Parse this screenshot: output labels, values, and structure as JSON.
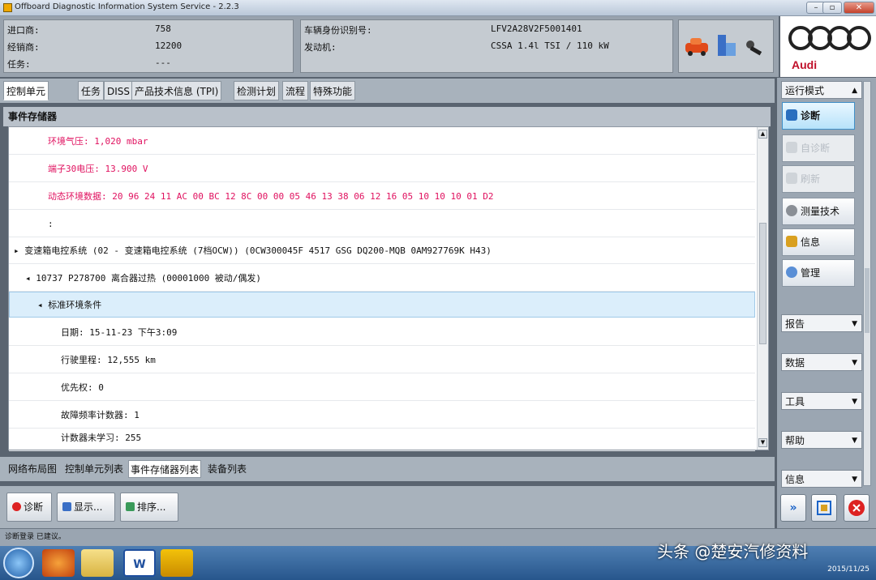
{
  "window": {
    "title": "Offboard Diagnostic Information System Service - 2.2.3",
    "minimize": "–",
    "restore": "▫",
    "close": "✕"
  },
  "header": {
    "left": [
      {
        "label": "进口商:",
        "value": "758"
      },
      {
        "label": "经销商:",
        "value": "12200"
      },
      {
        "label": "任务:",
        "value": "---"
      }
    ],
    "right": [
      {
        "label": "车辆身份识别号:",
        "value": "LFV2A28V2F5001401"
      },
      {
        "label": "发动机:",
        "value": "CSSA 1.4l TSI / 110 kW"
      }
    ],
    "brand": "Audi"
  },
  "tabs": [
    "控制单元",
    "任务",
    "DISS",
    "产品技术信息 (TPI)",
    "检测计划",
    "流程",
    "特殊功能"
  ],
  "panel_title": "事件存储器",
  "event_lines": [
    {
      "text": "环境气压: 1,020 mbar"
    },
    {
      "text": "端子30电压: 13.900 V"
    },
    {
      "text": "动态环境数据: 20 96 24 11 AC 00 BC 12 8C 00 00 05 46 13 38 06 12 16 05 10 10 10 01 D2"
    },
    {
      "text": ":"
    },
    {
      "text": "▸ 变速箱电控系统 (02 - 变速箱电控系统 (7档OCW)) (0CW300045F    4517   GSG DQ200-MQB    0AM927769K    H43)"
    },
    {
      "text": "◂ 10737   P278700   离合器过热  (00001000   被动/偶发)"
    },
    {
      "text": "◂ 标准环境条件"
    },
    {
      "text": "日期: 15-11-23 下午3:09"
    },
    {
      "text": "行驶里程: 12,555 km"
    },
    {
      "text": "优先权: 0"
    },
    {
      "text": "故障频率计数器: 1"
    },
    {
      "text": "计数器未学习: 255"
    }
  ],
  "bottom_tabs": [
    "网络布局图",
    "控制单元列表",
    "事件存储器列表",
    "装备列表"
  ],
  "actions": [
    "诊断",
    "显示...",
    "排序..."
  ],
  "status": "诊断登录 已建议。",
  "sidebar": {
    "mode_header": "运行模式",
    "buttons": [
      "诊断",
      "自诊断",
      "刷新",
      "测量技术",
      "信息",
      "管理"
    ],
    "sections": [
      "报告",
      "数据",
      "工具",
      "帮助",
      "信息"
    ]
  },
  "taskbar": {
    "clock": "2015/11/25"
  },
  "watermark": "头条 @楚安汽修资料",
  "colors": {
    "alert_text": "#e0115f",
    "selection": "#dbeefb",
    "brand_red": "#c0102a"
  }
}
